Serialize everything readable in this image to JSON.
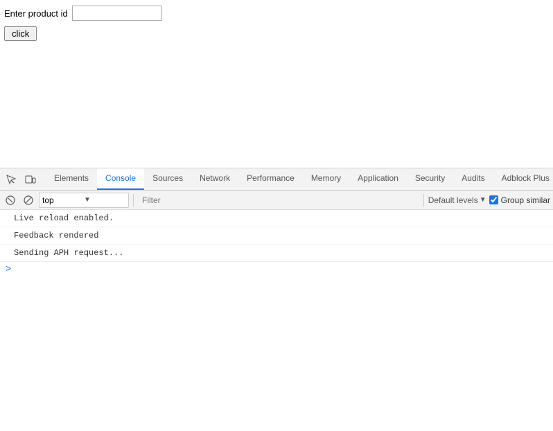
{
  "page": {
    "product_label": "Enter product id",
    "product_input_placeholder": "",
    "click_button_label": "click"
  },
  "devtools": {
    "tabs": [
      {
        "id": "elements",
        "label": "Elements",
        "active": false
      },
      {
        "id": "console",
        "label": "Console",
        "active": true
      },
      {
        "id": "sources",
        "label": "Sources",
        "active": false
      },
      {
        "id": "network",
        "label": "Network",
        "active": false
      },
      {
        "id": "performance",
        "label": "Performance",
        "active": false
      },
      {
        "id": "memory",
        "label": "Memory",
        "active": false
      },
      {
        "id": "application",
        "label": "Application",
        "active": false
      },
      {
        "id": "security",
        "label": "Security",
        "active": false
      },
      {
        "id": "audits",
        "label": "Audits",
        "active": false
      },
      {
        "id": "adblock-plus",
        "label": "Adblock Plus",
        "active": false
      }
    ],
    "console_toolbar": {
      "top_dropdown_value": "top",
      "filter_placeholder": "Filter",
      "default_levels_label": "Default levels",
      "group_similar_label": "Group similar",
      "group_similar_checked": true
    },
    "console_messages": [
      {
        "text": "Live reload enabled."
      },
      {
        "text": "Feedback rendered"
      },
      {
        "text": "Sending APH request..."
      }
    ],
    "console_prompt_symbol": ">"
  }
}
